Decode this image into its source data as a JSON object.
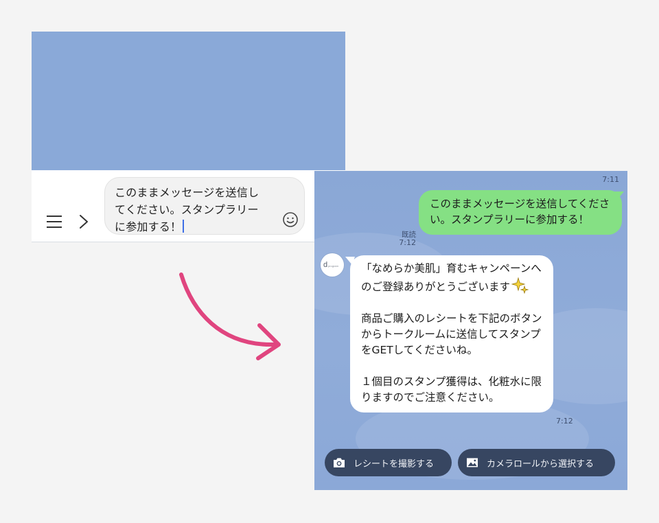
{
  "compose": {
    "input_text": "このままメッセージを送信し\nてください。スタンプラリー\nに参加する！",
    "icons": [
      "menu-icon",
      "chevron-right-icon",
      "smile-icon",
      "send-icon"
    ]
  },
  "arrow": {
    "color": "#e0457f"
  },
  "chat": {
    "top_time": "7:11",
    "sent_message": "このままメッセージを送信してください。スタンプラリーに参加する！",
    "read_label": "既読",
    "read_time": "7:12",
    "avatar_text": "d program",
    "received_message": {
      "paragraph_1": "「なめらか美肌」育むキャンペーンへのご登録ありがとうございます",
      "paragraph_2": "商品ご購入のレシートを下記のボタンからトークルームに送信してスタンプをGETしてくださいね。",
      "paragraph_3": "１個目のスタンプ獲得は、化粧水に限りますのでご注意ください。"
    },
    "received_time": "7:12",
    "quick_replies": [
      {
        "label": "レシートを撮影する",
        "icon": "camera-icon"
      },
      {
        "label": "カメラロールから選択する",
        "icon": "image-icon"
      }
    ],
    "colors": {
      "sent_bubble": "#85e084",
      "received_bubble": "#ffffff",
      "background": "#8aa9d8",
      "quick_reply": "#374661"
    }
  }
}
